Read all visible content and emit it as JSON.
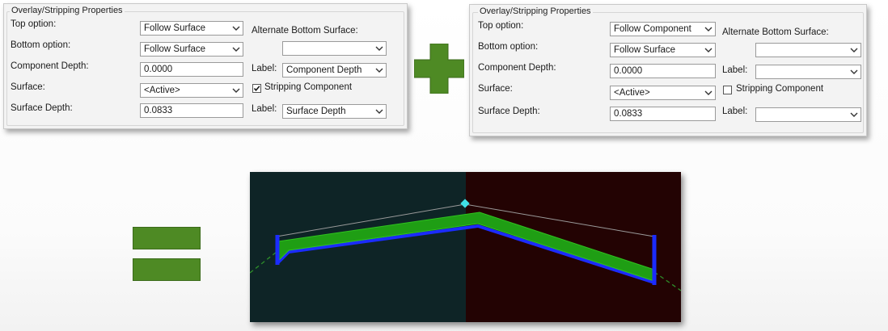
{
  "left_panel": {
    "group_title": "Overlay/Stripping Properties",
    "top_option_label": "Top option:",
    "top_option_value": "Follow Surface",
    "bottom_option_label": "Bottom option:",
    "bottom_option_value": "Follow Surface",
    "component_depth_label": "Component Depth:",
    "component_depth_value": "0.0000",
    "surface_label": "Surface:",
    "surface_value": "<Active>",
    "surface_depth_label": "Surface Depth:",
    "surface_depth_value": "0.0833",
    "alt_bottom_label": "Alternate Bottom Surface:",
    "alt_bottom_value": "",
    "label1_label": "Label:",
    "label1_value": "Component Depth",
    "stripping_label": "Stripping Component",
    "stripping_checked": true,
    "label2_label": "Label:",
    "label2_value": "Surface Depth"
  },
  "right_panel": {
    "group_title": "Overlay/Stripping Properties",
    "top_option_label": "Top option:",
    "top_option_value": "Follow Component",
    "bottom_option_label": "Bottom option:",
    "bottom_option_value": "Follow Surface",
    "component_depth_label": "Component Depth:",
    "component_depth_value": "0.0000",
    "surface_label": "Surface:",
    "surface_value": "<Active>",
    "surface_depth_label": "Surface Depth:",
    "surface_depth_value": "0.0833",
    "alt_bottom_label": "Alternate Bottom Surface:",
    "alt_bottom_value": "",
    "label1_label": "Label:",
    "label1_value": "",
    "stripping_label": "Stripping Component",
    "stripping_checked": false,
    "label2_label": "Label:",
    "label2_value": ""
  },
  "colors": {
    "plus_green": "#4e8a24",
    "viewport_left": "#0e2426",
    "viewport_right": "#230303",
    "component_green": "#1f9e14",
    "component_blue": "#1b2cff",
    "vertex_cyan": "#3fe0e6"
  },
  "icons": {
    "plus": "plus-sign-icon",
    "equals": "equals-sign-icon",
    "dropdown": "chevron-down-icon"
  }
}
